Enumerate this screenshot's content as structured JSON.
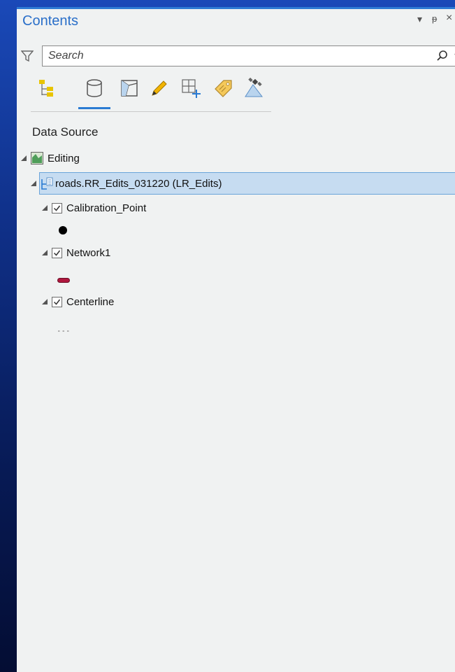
{
  "panel": {
    "title": "Contents",
    "controls": {
      "dropdown": "▾",
      "pin": "ᵽ",
      "close": "×"
    }
  },
  "search": {
    "placeholder": "Search"
  },
  "toolbar": {
    "buttons": [
      {
        "name": "list-by-drawing-order",
        "icon": "drawing-order-icon"
      },
      {
        "name": "list-by-data-source",
        "icon": "database-icon",
        "active": true
      },
      {
        "name": "list-by-selection",
        "icon": "selection-icon"
      },
      {
        "name": "list-by-editing",
        "icon": "pencil-icon"
      },
      {
        "name": "list-by-snapping",
        "icon": "snapping-icon"
      },
      {
        "name": "list-by-labeling",
        "icon": "label-tag-icon"
      },
      {
        "name": "list-by-perspective-imagery",
        "icon": "satellite-icon"
      }
    ]
  },
  "section": {
    "title": "Data Source"
  },
  "tree": {
    "map": {
      "label": "Editing"
    },
    "source": {
      "label": "roads.RR_Edits_031220 (LR_Edits)"
    },
    "layers": [
      {
        "label": "Calibration_Point",
        "checked": true,
        "symbol": "point",
        "color": "#000000"
      },
      {
        "label": "Network1",
        "checked": true,
        "symbol": "line",
        "color": "#b0173e"
      },
      {
        "label": "Centerline",
        "checked": true,
        "symbol": "dashed",
        "color": "#9a9a9a"
      }
    ]
  },
  "colors": {
    "accent": "#2a6fc9",
    "selection": "#c6dcf1"
  }
}
